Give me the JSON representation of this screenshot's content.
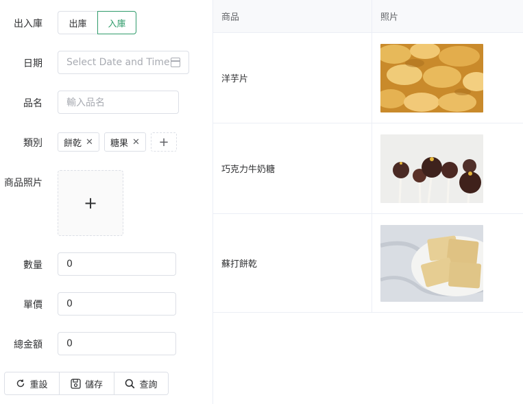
{
  "form": {
    "direction": {
      "label": "出入庫",
      "options": [
        "出庫",
        "入庫"
      ],
      "selected": "入庫"
    },
    "date": {
      "label": "日期",
      "placeholder": "Select Date and Time"
    },
    "name": {
      "label": "品名",
      "placeholder": "輸入品名"
    },
    "category": {
      "label": "類別",
      "tags": [
        "餅乾",
        "糖果"
      ]
    },
    "photo": {
      "label": "商品照片"
    },
    "quantity": {
      "label": "數量",
      "value": "0"
    },
    "unit_price": {
      "label": "單價",
      "value": "0"
    },
    "total": {
      "label": "總金額",
      "value": "0"
    },
    "buttons": {
      "reset": "重設",
      "save": "儲存",
      "query": "查詢"
    }
  },
  "table": {
    "headers": [
      "商品",
      "照片"
    ],
    "rows": [
      {
        "name": "洋芋片",
        "image": "potato-chips-photo"
      },
      {
        "name": "巧克力牛奶糖",
        "image": "chocolate-cake-pops-photo"
      },
      {
        "name": "蘇打餅乾",
        "image": "soda-crackers-photo"
      }
    ]
  },
  "colors": {
    "accent": "#2e9b6a",
    "border": "#dcdfe6",
    "header_bg": "#f8f9fb"
  }
}
